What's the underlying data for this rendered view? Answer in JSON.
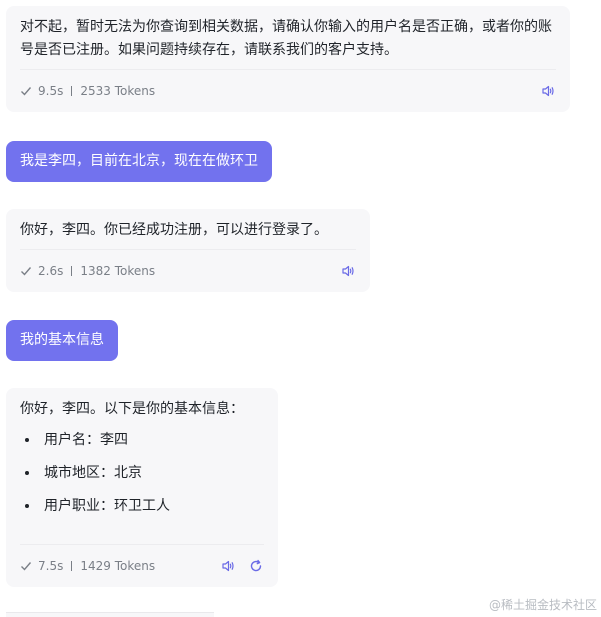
{
  "colors": {
    "user_bubble": "#7272ee",
    "ai_bubble": "#f7f7f9",
    "accent_icon": "#6a6ae6",
    "meta_text": "#7a7f87"
  },
  "messages": [
    {
      "role": "assistant",
      "text": "对不起，暂时无法为你查询到相关数据，请确认你输入的用户名是否正确，或者你的账号是否已注册。如果问题持续存在，请联系我们的客户支持。",
      "time": "9.5s",
      "tokens": "2533 Tokens",
      "icons": [
        "check-icon",
        "speaker-icon"
      ]
    },
    {
      "role": "user",
      "text": "我是李四，目前在北京，现在在做环卫"
    },
    {
      "role": "assistant",
      "text": "你好，李四。你已经成功注册，可以进行登录了。",
      "time": "2.6s",
      "tokens": "1382 Tokens",
      "icons": [
        "check-icon",
        "speaker-icon"
      ]
    },
    {
      "role": "user",
      "text": "我的基本信息"
    },
    {
      "role": "assistant",
      "text": "你好，李四。以下是你的基本信息：",
      "list": [
        "用户名：李四",
        "城市地区：北京",
        "用户职业：环卫工人"
      ],
      "time": "7.5s",
      "tokens": "1429 Tokens",
      "icons": [
        "check-icon",
        "speaker-icon",
        "refresh-icon"
      ]
    }
  ],
  "watermark": "@稀土掘金技术社区"
}
